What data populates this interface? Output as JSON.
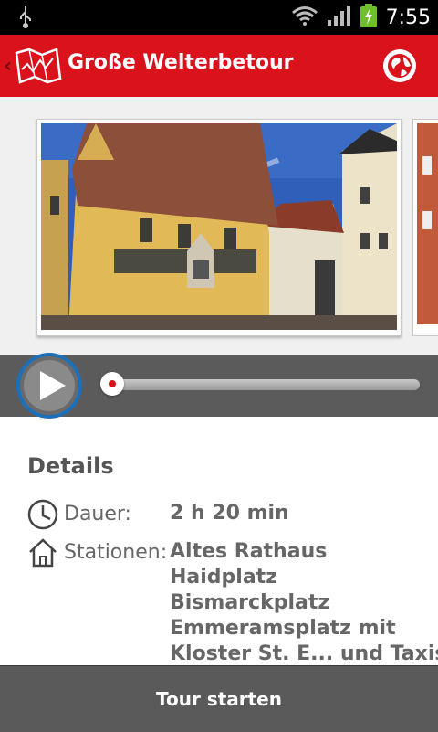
{
  "status_bar": {
    "time": "7:55",
    "icons": [
      "usb-icon",
      "wifi-icon",
      "signal-icon",
      "battery-charging-icon"
    ]
  },
  "header": {
    "title": "Große Welterbetour",
    "icon": "map-icon",
    "action_icon": "globe-icon",
    "brand_color": "#d9121b"
  },
  "gallery": {
    "images": [
      "photo-old-town-hall",
      "photo-next"
    ]
  },
  "player": {
    "play_icon": "play-icon",
    "progress": 0
  },
  "details": {
    "title": "Details",
    "duration_label": "Dauer:",
    "duration_value": "2 h 20 min",
    "stations_label": "Stationen:",
    "stations": [
      "Altes Rathaus",
      "Haidplatz",
      "Bismarckplatz",
      "Emmeramsplatz mit",
      "Kloster St. E... und Taxis"
    ]
  },
  "footer": {
    "start_label": "Tour starten"
  }
}
